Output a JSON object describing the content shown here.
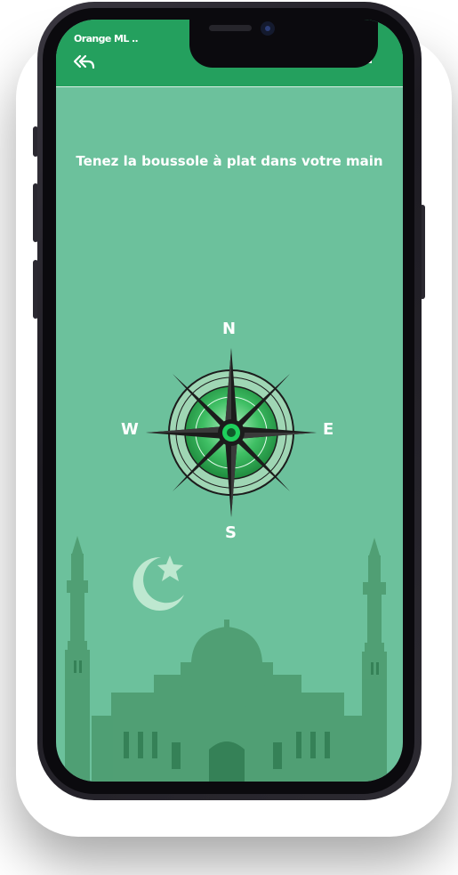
{
  "status_bar": {
    "carrier": "Orange ML .."
  },
  "header": {
    "back_icon": "double-chevron-back-icon",
    "home_icon": "home-icon"
  },
  "main": {
    "instruction": "Tenez la boussole à plat dans votre main",
    "compass": {
      "north": "N",
      "south": "S",
      "east": "E",
      "west": "W"
    }
  },
  "colors": {
    "appbar": "#24a05e",
    "background": "#6cc19c",
    "mosque_tint": "#4f9e72"
  }
}
